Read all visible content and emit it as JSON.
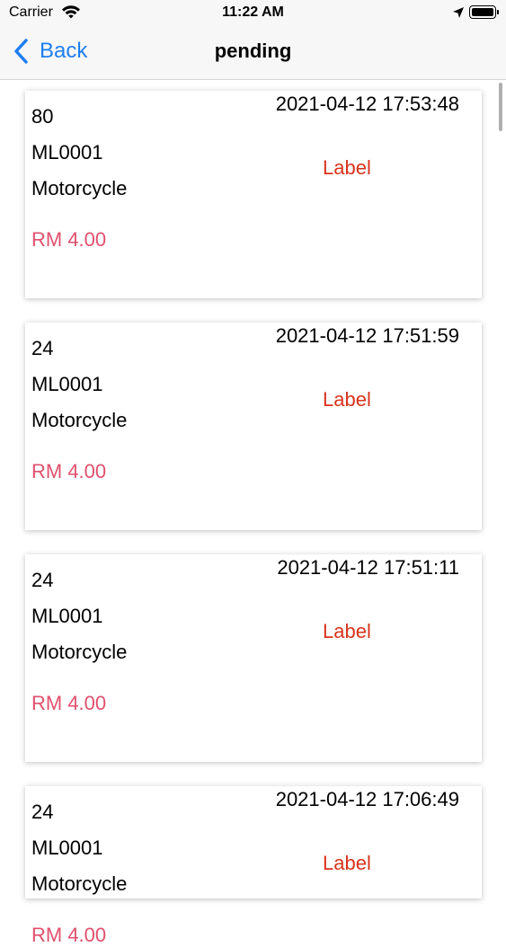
{
  "status_bar": {
    "carrier": "Carrier",
    "time": "11:22 AM"
  },
  "nav": {
    "back_label": "Back",
    "title": "pending"
  },
  "colors": {
    "accent": "#1e7ff0",
    "price": "#e0506e",
    "label": "#d9321b"
  },
  "orders": [
    {
      "number": "80",
      "code": "ML0001",
      "vehicle": "Motorcycle",
      "price": "RM 4.00",
      "datetime": "2021-04-12 17:53:48",
      "label": "Label"
    },
    {
      "number": "24",
      "code": "ML0001",
      "vehicle": "Motorcycle",
      "price": "RM 4.00",
      "datetime": "2021-04-12 17:51:59",
      "label": "Label"
    },
    {
      "number": "24",
      "code": "ML0001",
      "vehicle": "Motorcycle",
      "price": "RM 4.00",
      "datetime": "2021-04-12 17:51:11",
      "label": "Label"
    },
    {
      "number": "24",
      "code": "ML0001",
      "vehicle": "Motorcycle",
      "price": "RM 4.00",
      "datetime": "2021-04-12 17:06:49",
      "label": "Label"
    }
  ]
}
